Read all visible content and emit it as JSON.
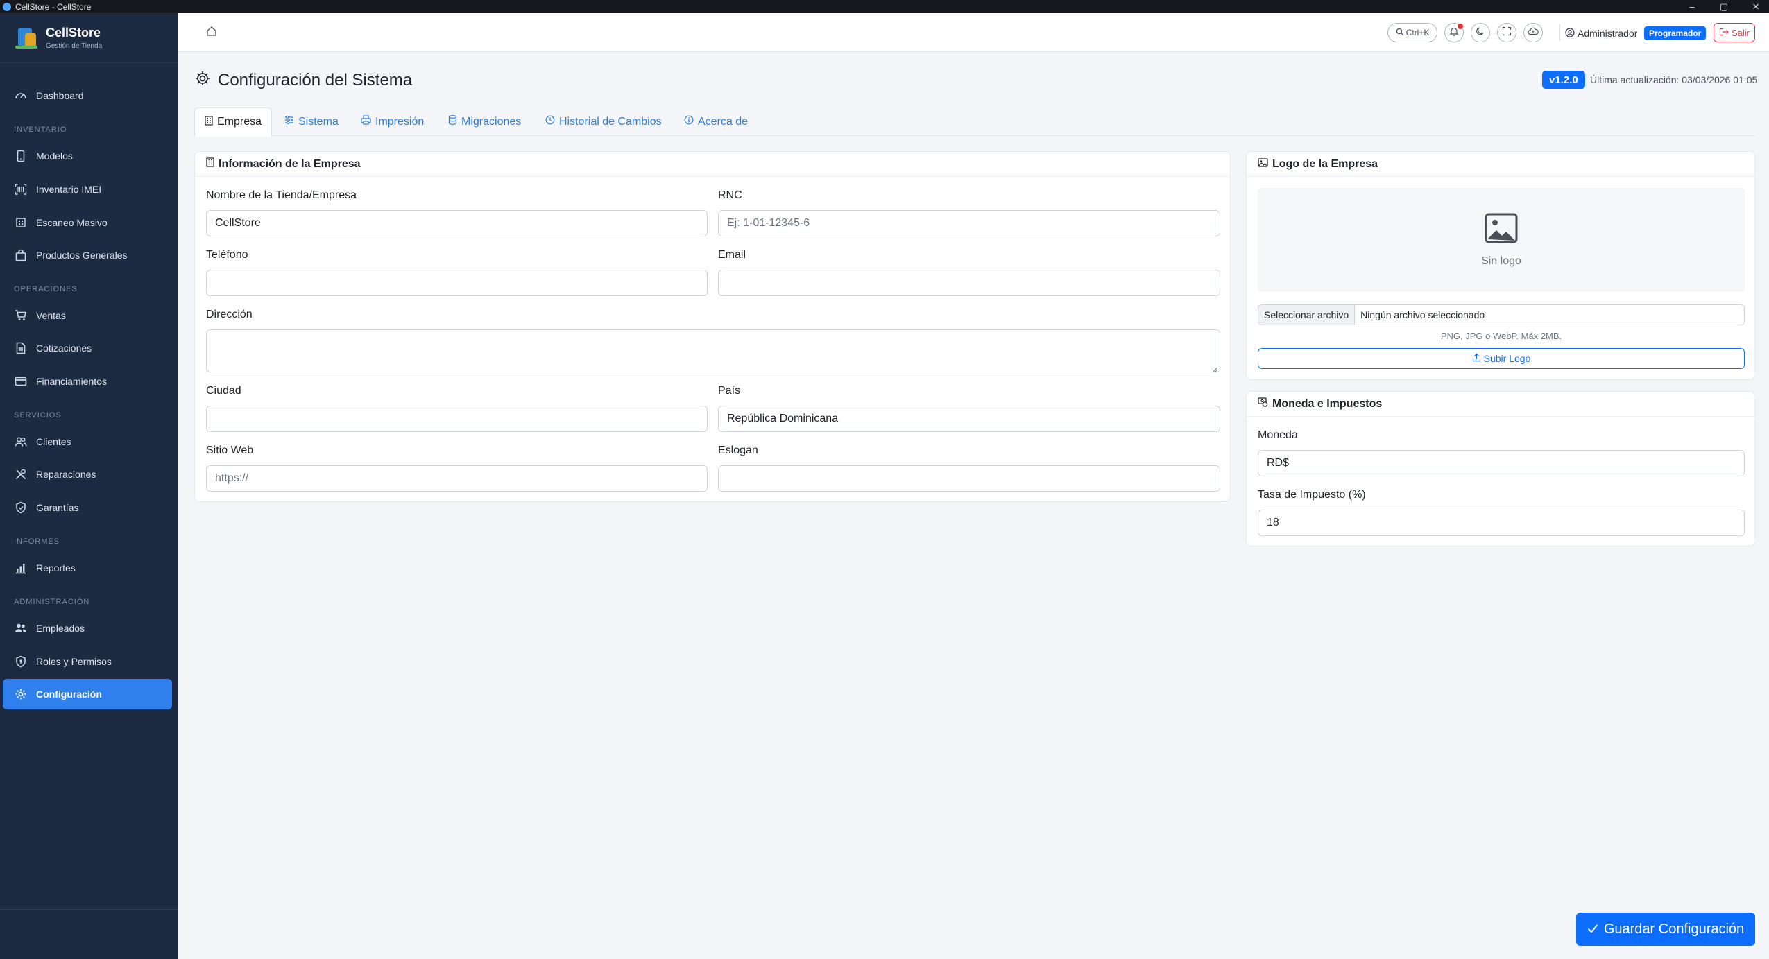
{
  "window": {
    "title": "CellStore - CellStore",
    "minimize": "–",
    "maximize": "▢",
    "close": "✕"
  },
  "brand": {
    "name": "CellStore",
    "subtitle": "Gestión de Tienda"
  },
  "sidebar": {
    "dashboard": "Dashboard",
    "sections": {
      "inventario": "INVENTARIO",
      "operaciones": "OPERACIONES",
      "servicios": "SERVICIOS",
      "informes": "INFORMES",
      "administracion": "ADMINISTRACIÓN"
    },
    "items": {
      "modelos": "Modelos",
      "inventario_imei": "Inventario IMEI",
      "escaneo_masivo": "Escaneo Masivo",
      "productos_generales": "Productos Generales",
      "ventas": "Ventas",
      "cotizaciones": "Cotizaciones",
      "financiamientos": "Financiamientos",
      "clientes": "Clientes",
      "reparaciones": "Reparaciones",
      "garantias": "Garantías",
      "reportes": "Reportes",
      "empleados": "Empleados",
      "roles": "Roles y Permisos",
      "configuracion": "Configuración"
    }
  },
  "header": {
    "search_shortcut": "Ctrl+K",
    "user_name": "Administrador",
    "role": "Programador",
    "logout": "Salir"
  },
  "page": {
    "title": "Configuración del Sistema",
    "version": "v1.2.0",
    "last_update": "Última actualización: 03/03/2026 01:05"
  },
  "tabs": {
    "empresa": "Empresa",
    "sistema": "Sistema",
    "impresion": "Impresión",
    "migraciones": "Migraciones",
    "historial": "Historial de Cambios",
    "acerca": "Acerca de"
  },
  "company": {
    "title": "Información de la Empresa",
    "name_label": "Nombre de la Tienda/Empresa",
    "name_value": "CellStore",
    "rnc_label": "RNC",
    "rnc_placeholder": "Ej: 1-01-12345-6",
    "phone_label": "Teléfono",
    "phone_value": "",
    "email_label": "Email",
    "email_value": "",
    "address_label": "Dirección",
    "address_value": "",
    "city_label": "Ciudad",
    "city_value": "",
    "country_label": "País",
    "country_value": "República Dominicana",
    "website_label": "Sitio Web",
    "website_placeholder": "https://",
    "slogan_label": "Eslogan",
    "slogan_value": ""
  },
  "logo": {
    "title": "Logo de la Empresa",
    "empty_text": "Sin logo",
    "file_button": "Seleccionar archivo",
    "file_name": "Ningún archivo seleccionado",
    "hint": "PNG, JPG o WebP. Máx 2MB.",
    "upload_button": "Subir Logo"
  },
  "currency": {
    "title": "Moneda e Impuestos",
    "currency_label": "Moneda",
    "currency_value": "RD$",
    "tax_label": "Tasa de Impuesto (%)",
    "tax_value": "18"
  },
  "save_button": "Guardar Configuración",
  "colors": {
    "sidebar_bg": "#1d2b42",
    "accent": "#0d6efd",
    "active_nav": "#2f80ed",
    "danger": "#dc3545"
  }
}
